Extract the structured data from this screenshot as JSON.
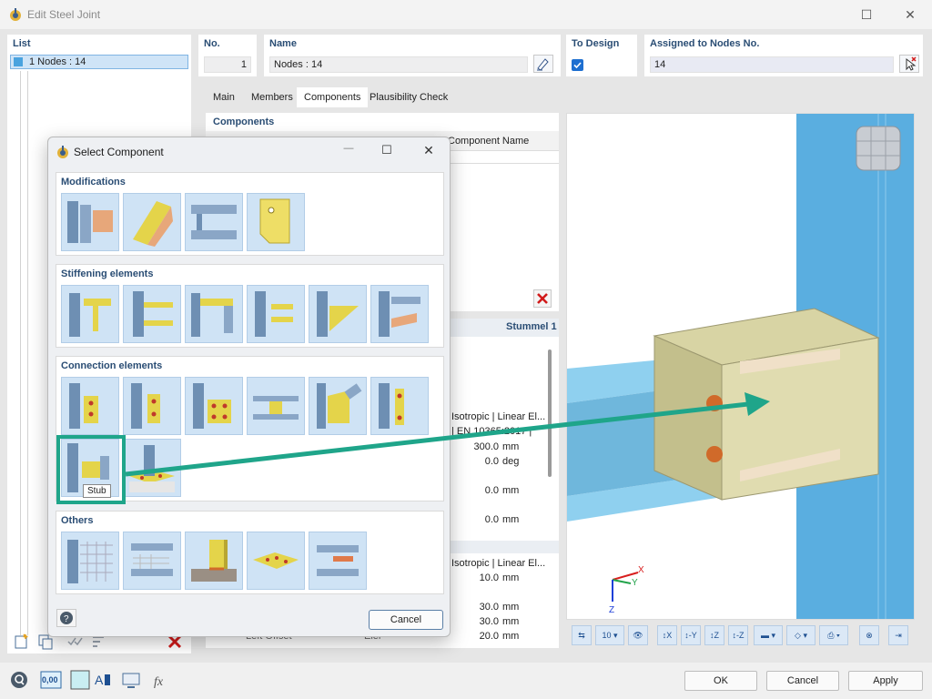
{
  "window": {
    "title": "Edit Steel Joint"
  },
  "list": {
    "header": "List",
    "items": [
      {
        "label": "1  Nodes : 14"
      }
    ]
  },
  "fields": {
    "no_label": "No.",
    "no_value": "1",
    "name_label": "Name",
    "name_value": "Nodes : 14",
    "to_design_label": "To Design",
    "to_design_checked": true,
    "assigned_label": "Assigned to Nodes No.",
    "assigned_value": "14"
  },
  "tabs": [
    "Main",
    "Members",
    "Components",
    "Plausibility Check"
  ],
  "active_tab": "Components",
  "components": {
    "header": "Components",
    "column_name": "Component Name",
    "detail_title": "Stummel 1",
    "rows_top": [
      {
        "text": "Isotropic | Linear El..."
      },
      {
        "text": "| EN 10365:2017 |"
      },
      {
        "value": "300.0",
        "unit": "mm"
      },
      {
        "value": "0.0",
        "unit": "deg"
      },
      {
        "value": "0.0",
        "unit": "mm"
      },
      {
        "value": "0.0",
        "unit": "mm"
      }
    ],
    "rows_bottom": [
      {
        "text": "Isotropic | Linear El..."
      },
      {
        "value": "10.0",
        "unit": "mm"
      },
      {
        "value": "30.0",
        "unit": "mm"
      },
      {
        "value": "30.0",
        "unit": "mm"
      },
      {
        "value": "20.0",
        "unit": "mm"
      }
    ],
    "partial_label": "Left Offset",
    "partial_value": "Eler"
  },
  "dialog": {
    "title": "Select Component",
    "groups": [
      {
        "title": "Modifications",
        "count": 4
      },
      {
        "title": "Stiffening elements",
        "count": 6
      },
      {
        "title": "Connection elements",
        "count": 8
      },
      {
        "title": "Others",
        "count": 5
      }
    ],
    "tooltip": "Stub",
    "cancel_label": "Cancel"
  },
  "view": {
    "toolbar_zoom": "10",
    "axis_x": "X",
    "axis_y": "Y",
    "axis_z": "Z"
  },
  "buttons": {
    "ok": "OK",
    "cancel": "Cancel",
    "apply": "Apply"
  },
  "bottom_icons": {
    "units_value": "0,00"
  },
  "colors": {
    "accent": "#1fa58a",
    "header_text": "#2a4d74",
    "column_blue": "#5aaee0",
    "beam_blue": "#8fd0ef",
    "plate": "#d8d4a4"
  }
}
